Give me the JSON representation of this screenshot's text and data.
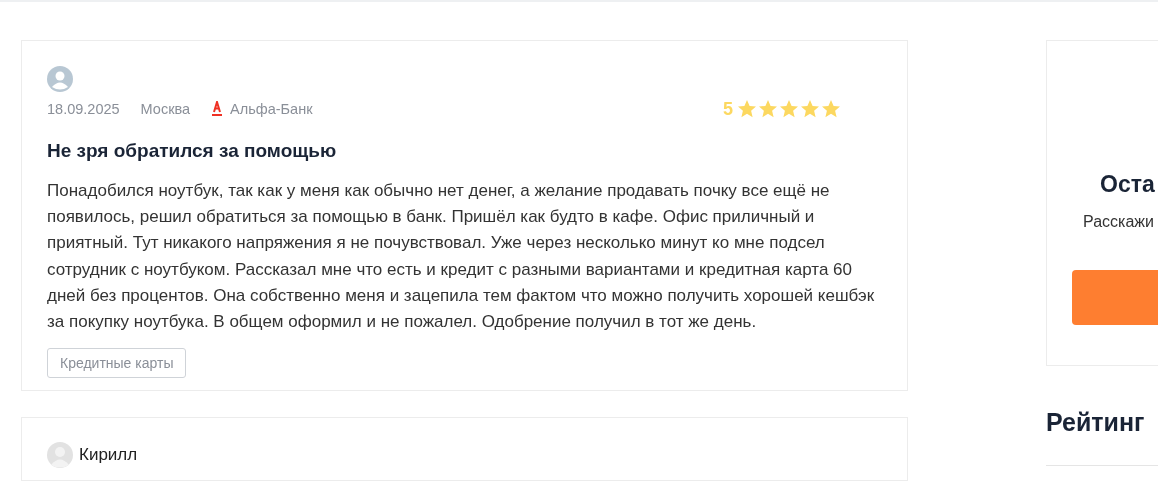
{
  "reviews": [
    {
      "date": "18.09.2025",
      "city": "Москва",
      "bank": "Альфа-Банк",
      "rating": "5",
      "stars": 5,
      "title": "Не зря обратился за помощью",
      "text": "Понадобился ноутбук, так как у меня как обычно нет денег, а желание продавать почку все ещё не появилось, решил обратиться за помощью в банк. Пришёл как будто в кафе. Офис приличный и приятный. Тут никакого напряжения я не почувствовал. Уже через несколько минут ко мне подсел сотрудник с ноутбуком. Рассказал мне что есть и кредит с разными вариантами и кредитная карта 60 дней без процентов. Она собственно меня и зацепила тем фактом что можно получить хорошей кешбэк за покупку ноутбука. В общем оформил и не пожалел. Одобрение получил в тот же день.",
      "tag": "Кредитные карты"
    },
    {
      "author": "Кирилл"
    }
  ],
  "sidebar": {
    "cta_title": "Оста",
    "cta_text": "Расскажи",
    "rating_title": "Рейтинг"
  }
}
